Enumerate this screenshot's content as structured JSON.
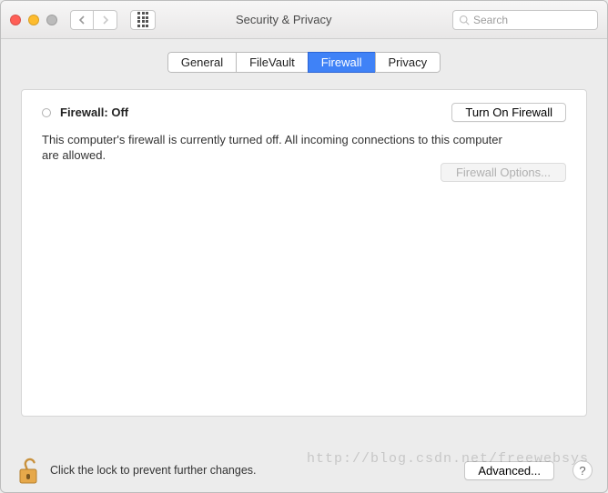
{
  "window": {
    "title": "Security & Privacy"
  },
  "search": {
    "placeholder": "Search"
  },
  "tabs": [
    {
      "label": "General"
    },
    {
      "label": "FileVault"
    },
    {
      "label": "Firewall",
      "active": true
    },
    {
      "label": "Privacy"
    }
  ],
  "firewall": {
    "status_label": "Firewall: Off",
    "turn_on_label": "Turn On Firewall",
    "description": "This computer's firewall is currently turned off. All incoming connections to this computer are allowed.",
    "options_label": "Firewall Options..."
  },
  "footer": {
    "lock_text": "Click the lock to prevent further changes.",
    "advanced_label": "Advanced...",
    "help_label": "?"
  },
  "watermark": "http://blog.csdn.net/freewebsys"
}
